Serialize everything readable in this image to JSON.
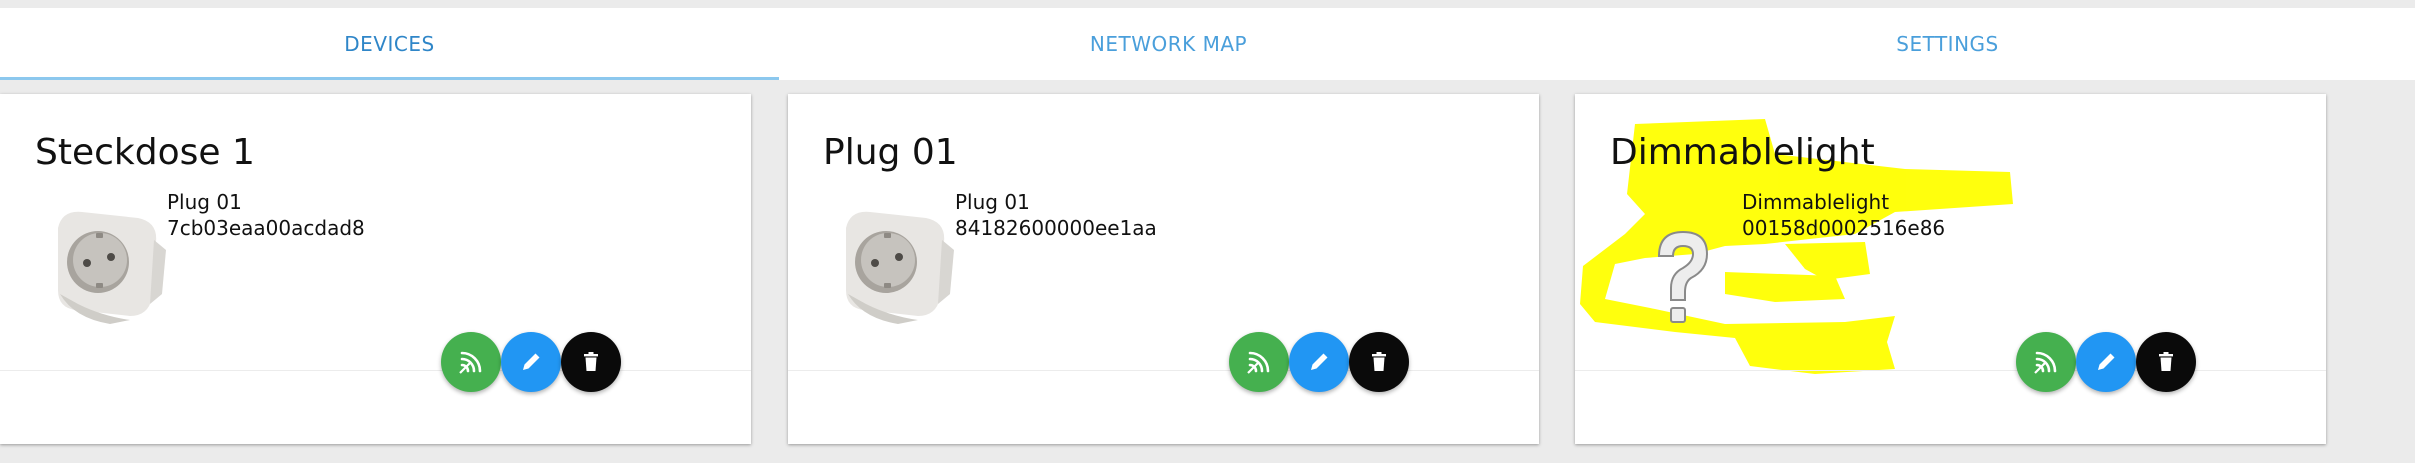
{
  "tabs": [
    {
      "label": "DEVICES",
      "active": true
    },
    {
      "label": "NETWORK MAP",
      "active": false
    },
    {
      "label": "SETTINGS",
      "active": false
    }
  ],
  "cards": [
    {
      "title": "Steckdose 1",
      "model": "Plug 01",
      "id": "7cb03eaa00acdad8",
      "image": "plug-icon"
    },
    {
      "title": "Plug 01",
      "model": "Plug 01",
      "id": "84182600000ee1aa",
      "image": "plug-icon"
    },
    {
      "title": "Dimmablelight",
      "model": "Dimmablelight",
      "id": "00158d0002516e86",
      "image": "question-mark-icon"
    }
  ],
  "buttons": {
    "network": "network-icon",
    "edit": "pencil-icon",
    "delete": "trash-icon"
  },
  "colors": {
    "tab_text": "#4a9fdb",
    "network_button": "#45b04f",
    "edit_button": "#2196f3",
    "delete_button": "#0a0a0a",
    "highlight": "#ffff00"
  }
}
